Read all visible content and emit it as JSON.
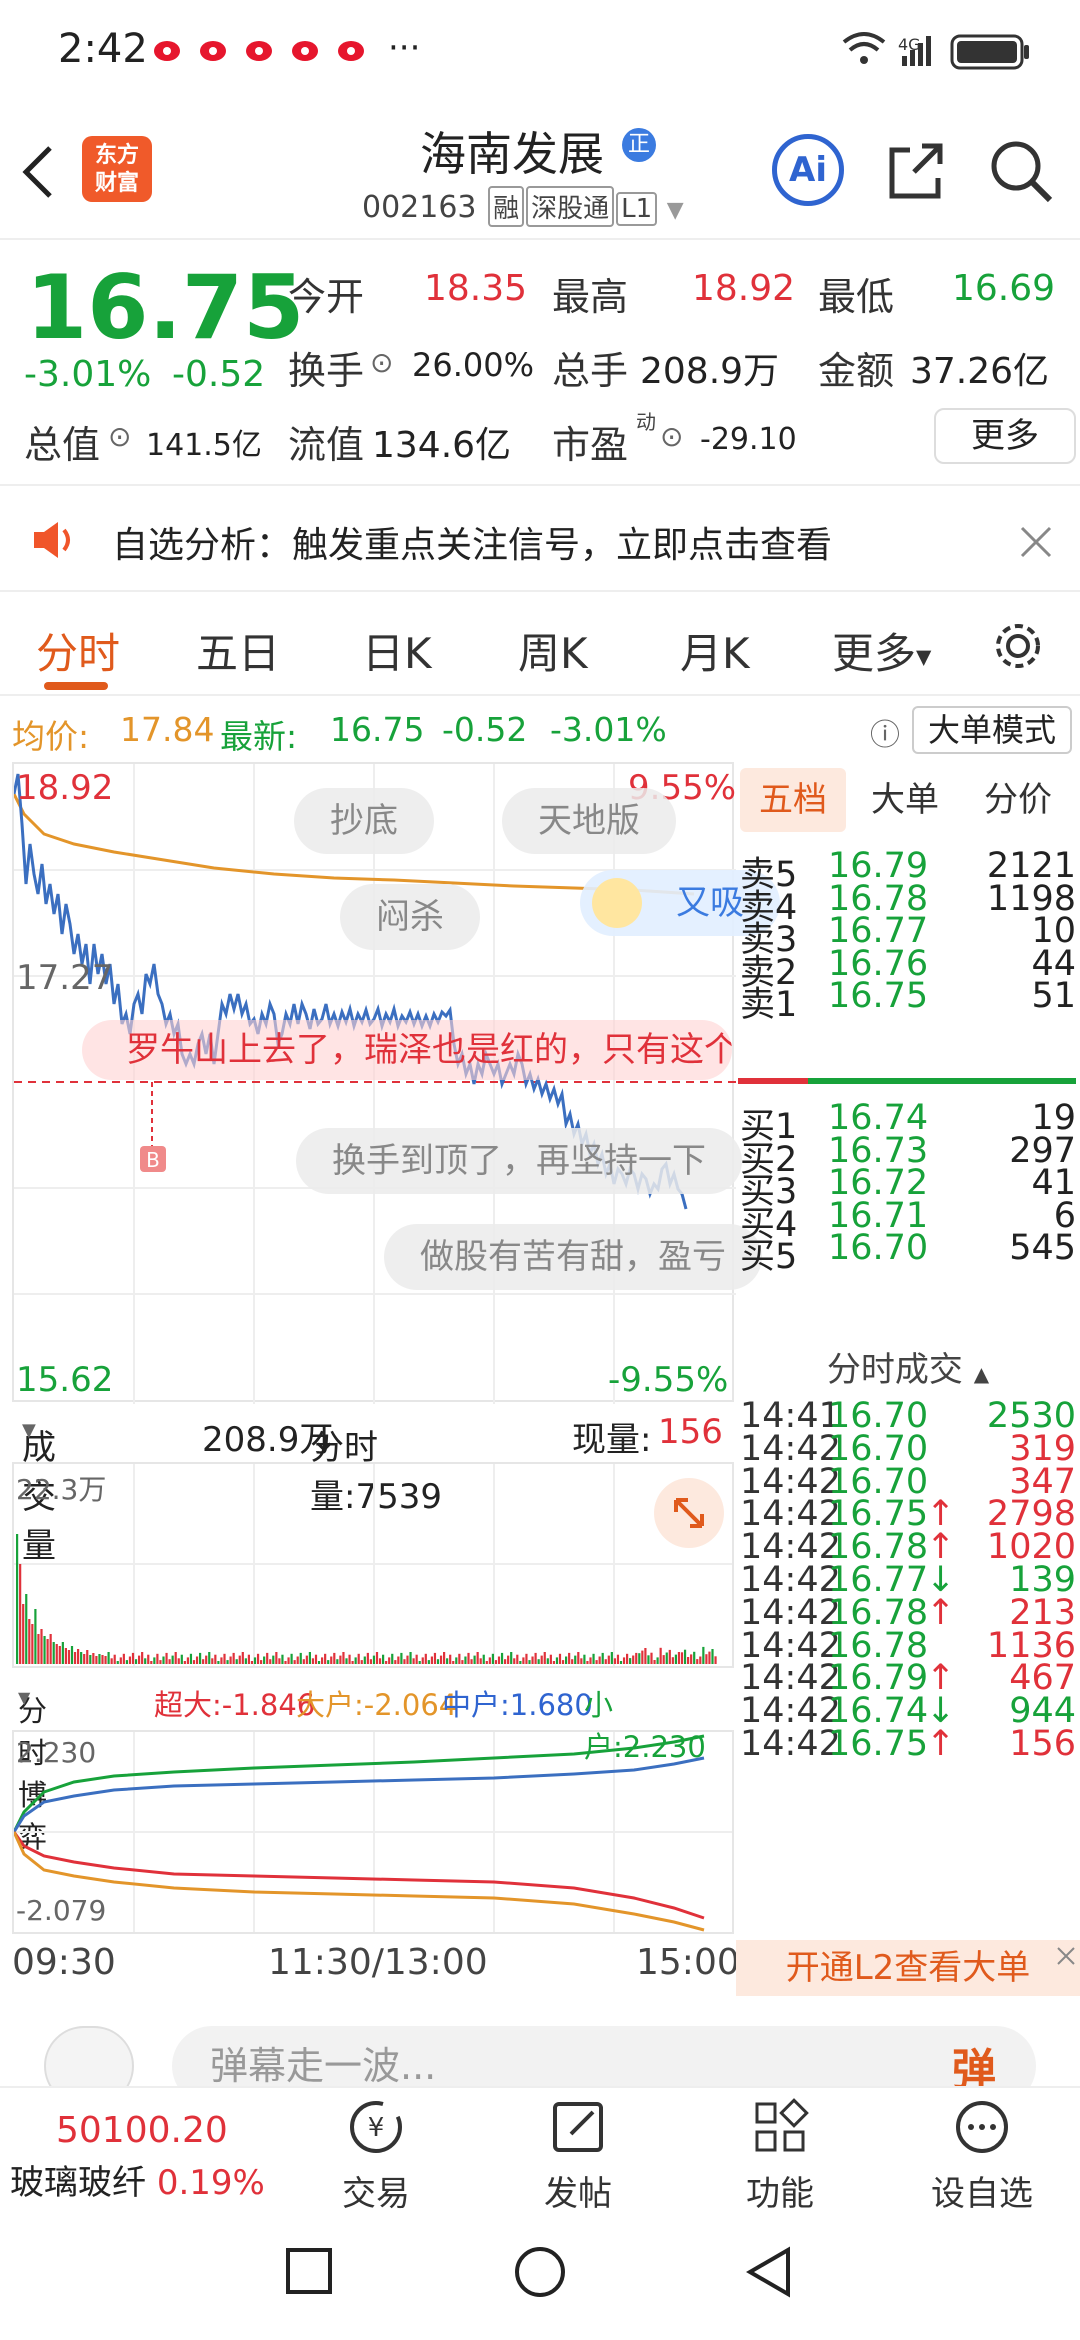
{
  "status_bar": {
    "time": "2:42",
    "dots": "···",
    "network": "4G"
  },
  "header": {
    "logo_line1": "东方",
    "logo_line2": "财富",
    "stock_name": "海南发展",
    "name_badge": "正",
    "stock_code": "002163",
    "tags": [
      "融",
      "深股通",
      "L1"
    ],
    "ai_label": "Ai"
  },
  "quote": {
    "price": "16.75",
    "change_pct": "-3.01%",
    "change_amt": "-0.52",
    "open_label": "今开",
    "open_value": "18.35",
    "high_label": "最高",
    "high_value": "18.92",
    "low_label": "最低",
    "low_value": "16.69",
    "turnover_label": "换手",
    "turnover_value": "26.00%",
    "volume_label": "总手",
    "volume_value": "208.9万",
    "amount_label": "金额",
    "amount_value": "37.26亿",
    "mktcap_label": "总值",
    "mktcap_value": "141.5亿",
    "float_label": "流值",
    "float_value": "134.6亿",
    "pe_label": "市盈",
    "pe_sup": "动",
    "pe_value": "-29.10",
    "more_button": "更多"
  },
  "banner": {
    "text": "自选分析：触发重点关注信号，立即点击查看"
  },
  "tabs": [
    "分时",
    "五日",
    "日K",
    "周K",
    "月K",
    "更多"
  ],
  "info_line": {
    "avg_label": "均价:",
    "avg_value": "17.84",
    "latest_label": "最新:",
    "latest_value": "16.75",
    "chg": "-0.52",
    "chg_pct": "-3.01%",
    "mode_button": "大单模式"
  },
  "chart": {
    "high_price": "18.92",
    "high_pct": "9.55%",
    "low_price": "15.62",
    "low_pct": "-9.55%",
    "ref_price": "17.27",
    "marker": "B",
    "bubbles": [
      "抄底",
      "天地版",
      "闷杀",
      "又吸",
      "罗牛山上去了，瑞泽也是红的，只有这个",
      "换手到顶了，再坚持一下",
      "做股有苦有甜，盈亏"
    ]
  },
  "volume": {
    "selector": "成交量",
    "total": "208.9万",
    "tick_label": "分时量:7539",
    "tick_arrow": "↓",
    "now_label": "现量:",
    "now_value": "156",
    "max_label": "22.3万"
  },
  "game": {
    "selector": "分时博弈",
    "super_label": "超大:-1.846",
    "big_label": "大户:-2.064",
    "mid_label": "中户:1.680",
    "small_label": "小户:2.230",
    "top_val": "2.230",
    "bottom_val": "-2.079"
  },
  "time_axis": [
    "09:30",
    "11:30/13:00",
    "15:00"
  ],
  "orderbook": {
    "tabs": [
      "五档",
      "大单",
      "分价"
    ],
    "asks": [
      {
        "label": "卖5",
        "price": "16.79",
        "vol": "2121"
      },
      {
        "label": "卖4",
        "price": "16.78",
        "vol": "1198"
      },
      {
        "label": "卖3",
        "price": "16.77",
        "vol": "10"
      },
      {
        "label": "卖2",
        "price": "16.76",
        "vol": "44"
      },
      {
        "label": "卖1",
        "price": "16.75",
        "vol": "51"
      }
    ],
    "bids": [
      {
        "label": "买1",
        "price": "16.74",
        "vol": "19"
      },
      {
        "label": "买2",
        "price": "16.73",
        "vol": "297"
      },
      {
        "label": "买3",
        "price": "16.72",
        "vol": "41"
      },
      {
        "label": "买4",
        "price": "16.71",
        "vol": "6"
      },
      {
        "label": "买5",
        "price": "16.70",
        "vol": "545"
      }
    ]
  },
  "ticks": {
    "title": "分时成交",
    "rows": [
      {
        "time": "14:41",
        "price": "16.70",
        "arrow": "",
        "vol": "2530",
        "color": "green"
      },
      {
        "time": "14:42",
        "price": "16.70",
        "arrow": "",
        "vol": "319",
        "color": "red"
      },
      {
        "time": "14:42",
        "price": "16.70",
        "arrow": "",
        "vol": "347",
        "color": "red"
      },
      {
        "time": "14:42",
        "price": "16.75",
        "arrow": "↑",
        "vol": "2798",
        "color": "red"
      },
      {
        "time": "14:42",
        "price": "16.78",
        "arrow": "↑",
        "vol": "1020",
        "color": "red"
      },
      {
        "time": "14:42",
        "price": "16.77",
        "arrow": "↓",
        "vol": "139",
        "color": "green"
      },
      {
        "time": "14:42",
        "price": "16.78",
        "arrow": "↑",
        "vol": "213",
        "color": "red"
      },
      {
        "time": "14:42",
        "price": "16.78",
        "arrow": "",
        "vol": "1136",
        "color": "red"
      },
      {
        "time": "14:42",
        "price": "16.79",
        "arrow": "↑",
        "vol": "467",
        "color": "red"
      },
      {
        "time": "14:42",
        "price": "16.74",
        "arrow": "↓",
        "vol": "944",
        "color": "green"
      },
      {
        "time": "14:42",
        "price": "16.75",
        "arrow": "↑",
        "vol": "156",
        "color": "red"
      }
    ],
    "l2_button": "开通L2查看大单"
  },
  "danmu": {
    "placeholder": "弹幕走一波...",
    "send_label": "弹"
  },
  "bottom_nav": {
    "index_value": "50100.20",
    "index_name": "玻璃玻纤",
    "index_change": "0.19%",
    "items": [
      "交易",
      "发帖",
      "功能",
      "设自选"
    ]
  },
  "colors": {
    "up": "#e0313a",
    "down": "#17a23a",
    "accent": "#e05a1c",
    "avg": "#e3952a",
    "price_line": "#3b6fc0"
  }
}
